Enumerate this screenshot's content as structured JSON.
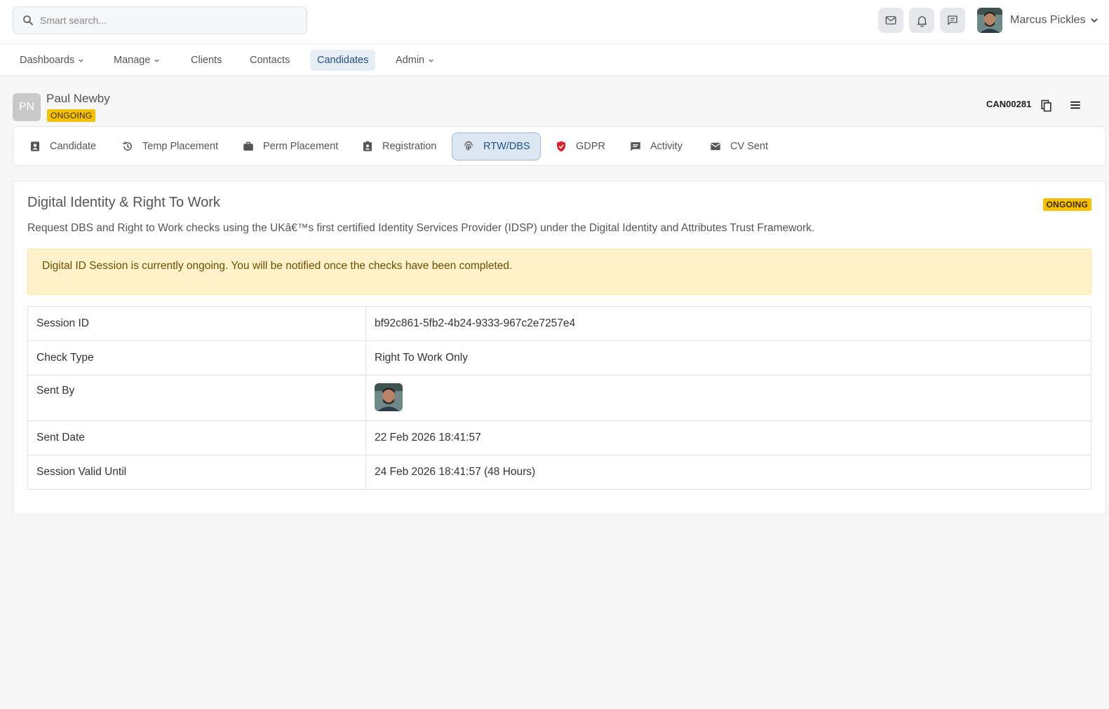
{
  "search": {
    "placeholder": "Smart search..."
  },
  "top_icons": [
    "mail-icon",
    "bell-icon",
    "chat-icon"
  ],
  "user": {
    "name": "Marcus Pickles"
  },
  "nav": {
    "dashboards": "Dashboards",
    "manage": "Manage",
    "clients": "Clients",
    "contacts": "Contacts",
    "candidates": "Candidates",
    "admin": "Admin"
  },
  "candidate": {
    "initials": "PN",
    "name": "Paul Newby",
    "status": "ONGOING",
    "ref": "CAN00281"
  },
  "tabs": {
    "candidate": "Candidate",
    "temp_placement": "Temp Placement",
    "perm_placement": "Perm Placement",
    "registration": "Registration",
    "rtw_dbs": "RTW/DBS",
    "gdpr": "GDPR",
    "activity": "Activity",
    "cv_sent": "CV Sent"
  },
  "panel": {
    "title": "Digital Identity & Right To Work",
    "status": "ONGOING",
    "description": "Request DBS and Right to Work checks using the UKâ€™s first certified Identity Services Provider (IDSP) under the Digital Identity and Attributes Trust Framework.",
    "alert": "Digital ID Session is currently ongoing. You will be notified once the checks have been completed.",
    "rows": {
      "session_id": {
        "label": "Session ID",
        "value": "bf92c861-5fb2-4b24-9333-967c2e7257e4"
      },
      "check_type": {
        "label": "Check Type",
        "value": "Right To Work Only"
      },
      "sent_by": {
        "label": "Sent By"
      },
      "sent_date": {
        "label": "Sent Date",
        "value": "22 Feb 2026 18:41:57"
      },
      "valid_until": {
        "label": "Session Valid Until",
        "value": "24 Feb 2026 18:41:57 (48 Hours)"
      }
    }
  },
  "colors": {
    "accent": "#1f4f86",
    "badge": "#f5c000",
    "alert_bg": "#fff2cb",
    "gdpr_icon": "#d9232e"
  }
}
